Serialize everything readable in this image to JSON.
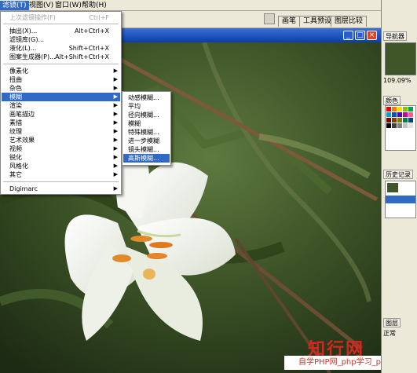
{
  "menubar": {
    "items": [
      "滤镜(T)",
      "视图(V)",
      "窗口(W)",
      "帮助(H)"
    ]
  },
  "toolbar_tabs": [
    "画笔",
    "工具预设",
    "图层比较"
  ],
  "filter_menu": {
    "items": [
      {
        "label": "上次滤镜操作(F)",
        "shortcut": "Ctrl+F",
        "disabled": true
      },
      {
        "label": "抽出(X)...",
        "shortcut": "Alt+Ctrl+X"
      },
      {
        "label": "滤镜库(G)...",
        "shortcut": ""
      },
      {
        "label": "液化(L)...",
        "shortcut": "Shift+Ctrl+X"
      },
      {
        "label": "图案生成器(P)...",
        "shortcut": "Alt+Shift+Ctrl+X"
      },
      {
        "label": "像素化"
      },
      {
        "label": "扭曲"
      },
      {
        "label": "杂色"
      },
      {
        "label": "模糊"
      },
      {
        "label": "渲染"
      },
      {
        "label": "画笔描边"
      },
      {
        "label": "素描"
      },
      {
        "label": "纹理"
      },
      {
        "label": "艺术效果"
      },
      {
        "label": "视频"
      },
      {
        "label": "锐化"
      },
      {
        "label": "风格化"
      },
      {
        "label": "其它"
      },
      {
        "label": "Digimarc"
      }
    ]
  },
  "blur_submenu": {
    "items": [
      "动感模糊...",
      "平均",
      "径向模糊...",
      "模糊",
      "特殊模糊...",
      "进一步模糊",
      "镜头模糊...",
      "高斯模糊..."
    ]
  },
  "right_panel": {
    "navigator": "导航器",
    "zoom": "109.09%",
    "color_tab": "颜色",
    "history_tab": "历史记录",
    "layers_tab": "图层",
    "blend_mode": "正常"
  },
  "watermark": {
    "big": "知行网",
    "small": "自学PHP网_php学习_php教"
  },
  "colors": {
    "accent": "#316ac5",
    "menu_bg": "#ffffff",
    "chrome": "#ece9d8",
    "title_blue": "#0a3ea8"
  }
}
